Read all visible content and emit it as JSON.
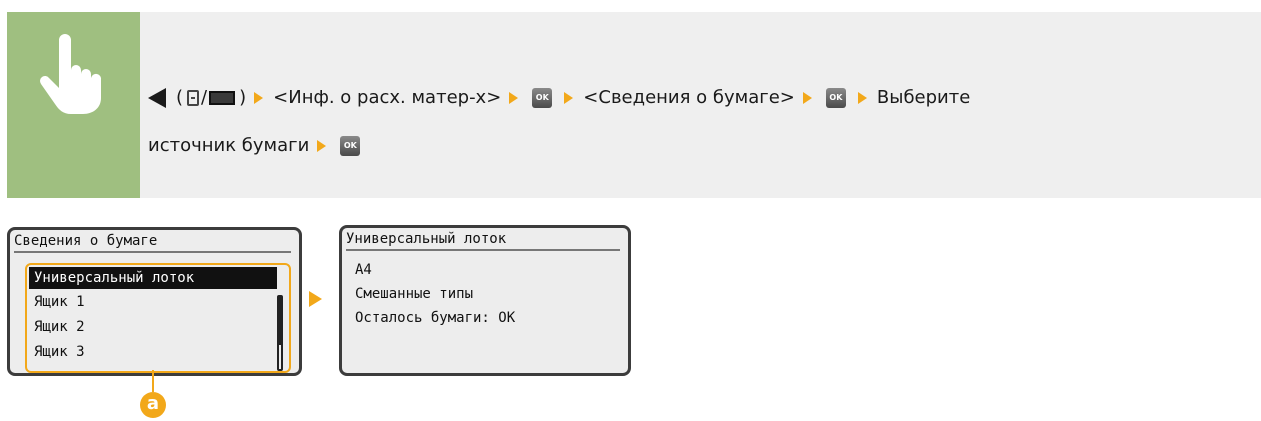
{
  "instruction": {
    "hand_icon": "hand-pointer-icon",
    "back_icon": "triangle-left-icon",
    "open_paren": "(",
    "slash": "/",
    "close_paren": ")",
    "step1": "<Инф. о расх. матер-х>",
    "ok_label": "OK",
    "step2": "<Сведения о бумаге>",
    "step3_part1": "Выберите",
    "step3_part2": "источник бумаги",
    "arrow_color": "#f2a81a",
    "panel_color": "#9fbf80"
  },
  "screen1": {
    "title": "Сведения о бумаге",
    "items": [
      "Универсальный лоток",
      "Ящик 1",
      "Ящик 2",
      "Ящик 3"
    ],
    "selected_index": 0
  },
  "screen2": {
    "title": "Универсальный лоток",
    "lines": [
      "A4",
      "Смешанные типы",
      "Осталось бумаги: OK"
    ]
  },
  "callout": {
    "label": "a"
  }
}
